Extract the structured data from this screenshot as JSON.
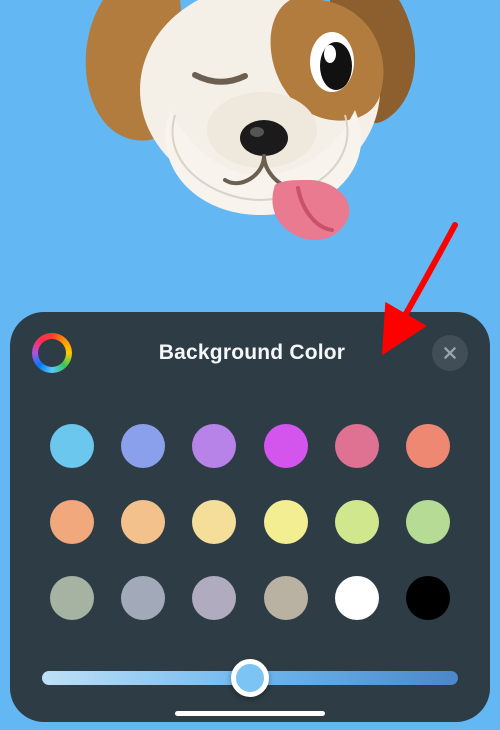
{
  "preview": {
    "memoji_name": "Dog",
    "background_color": "#63b8f3"
  },
  "sheet": {
    "title": "Background Color",
    "color_wheel_label": "color-wheel",
    "close_label": "close",
    "swatches": [
      {
        "name": "sky-blue",
        "hex": "#6cc7ef",
        "selected": true
      },
      {
        "name": "periwinkle",
        "hex": "#8ba0ec",
        "selected": false
      },
      {
        "name": "lavender",
        "hex": "#b883e8",
        "selected": false
      },
      {
        "name": "magenta",
        "hex": "#d454ee",
        "selected": false
      },
      {
        "name": "rose",
        "hex": "#df7292",
        "selected": false
      },
      {
        "name": "coral",
        "hex": "#ee8873",
        "selected": false
      },
      {
        "name": "peach",
        "hex": "#f2a87d",
        "selected": false
      },
      {
        "name": "apricot",
        "hex": "#f2c18c",
        "selected": false
      },
      {
        "name": "butter",
        "hex": "#f4de9a",
        "selected": false
      },
      {
        "name": "lemon",
        "hex": "#f2ee91",
        "selected": false
      },
      {
        "name": "lime",
        "hex": "#d1e78e",
        "selected": false
      },
      {
        "name": "sage",
        "hex": "#b5db94",
        "selected": false
      },
      {
        "name": "moss",
        "hex": "#a6b3a2",
        "selected": false
      },
      {
        "name": "storm",
        "hex": "#a2aaba",
        "selected": false
      },
      {
        "name": "lilac-gray",
        "hex": "#b1abc0",
        "selected": false
      },
      {
        "name": "taupe",
        "hex": "#b9b2a2",
        "selected": false
      },
      {
        "name": "white",
        "hex": "#ffffff",
        "selected": false
      },
      {
        "name": "black",
        "hex": "#000000",
        "selected": false
      }
    ],
    "slider": {
      "min": 0,
      "max": 100,
      "value": 50,
      "track_gradient_from": "#bfe1f7",
      "track_gradient_to": "#4b87c9",
      "thumb_color": "#7cc4f4"
    }
  },
  "annotation": {
    "arrow_color": "#ff0000"
  }
}
